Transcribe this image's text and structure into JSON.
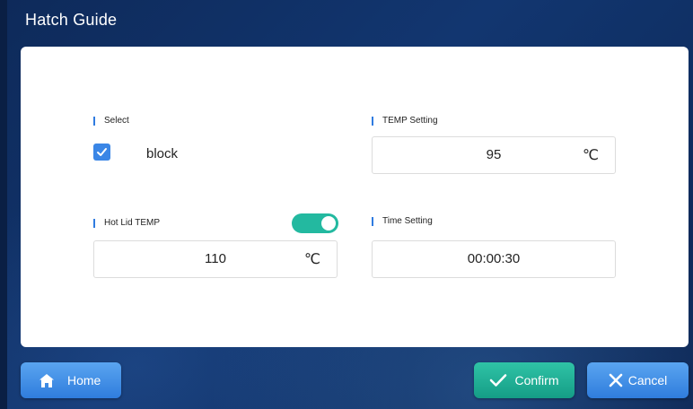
{
  "window": {
    "title": "Hatch Guide"
  },
  "select": {
    "label": "Select",
    "checkbox_label": "block",
    "checked": true
  },
  "temp_setting": {
    "label": "TEMP Setting",
    "value": "95",
    "unit": "℃"
  },
  "hot_lid": {
    "label": "Hot Lid TEMP",
    "enabled": true,
    "value": "110",
    "unit": "℃"
  },
  "time_setting": {
    "label": "Time Setting",
    "value": "00:00:30"
  },
  "buttons": {
    "home": {
      "label": "Home",
      "icon": "home-icon"
    },
    "confirm": {
      "label": "Confirm",
      "icon": "checkmark-icon"
    },
    "cancel": {
      "label": "Cancel",
      "icon": "close-icon"
    }
  },
  "colors": {
    "background": "#123670",
    "accent_blue": "#3a86e6",
    "accent_teal": "#23b9a0"
  }
}
